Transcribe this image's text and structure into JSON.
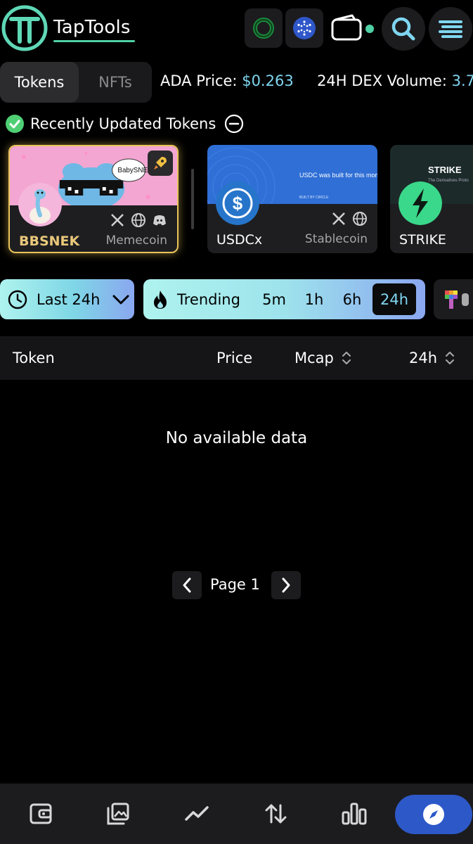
{
  "header": {
    "brand": "TapTools",
    "icons": [
      "logo-icon",
      "ring-icon",
      "cardano-icon",
      "wallet-icon",
      "search-icon",
      "menu-icon"
    ],
    "wallet_status_color": "#4fd1a5"
  },
  "tabs": [
    {
      "label": "Tokens",
      "active": true
    },
    {
      "label": "NFTs",
      "active": false
    }
  ],
  "ticker": {
    "ada_label": "ADA Price:",
    "ada_value": "$0.263",
    "volume_label": "24H DEX Volume:",
    "volume_value": "3.7"
  },
  "recent": {
    "title": "Recently Updated Tokens",
    "cards": [
      {
        "name": "BBSNEK",
        "category": "Memecoin",
        "banner_text": "BabySNE",
        "socials": [
          "x-icon",
          "globe-icon",
          "discord-icon"
        ],
        "badge": "rocket-icon"
      },
      {
        "name": "USDCx",
        "category": "Stablecoin",
        "banner_text": "USDC was built for this moment.",
        "banner_footer": "BUILT BY CIRCLE",
        "socials": [
          "x-icon",
          "globe-icon"
        ]
      },
      {
        "name": "STRIKE",
        "banner_text": "STRIKE",
        "banner_sub": "The Derivatives Proto"
      }
    ]
  },
  "filters": {
    "time": "Last 24h",
    "trending_label": "Trending",
    "timeframes": [
      {
        "label": "5m",
        "active": false
      },
      {
        "label": "1h",
        "active": false
      },
      {
        "label": "6h",
        "active": false
      },
      {
        "label": "24h",
        "active": true
      }
    ]
  },
  "table": {
    "columns": [
      "Token",
      "Price",
      "Mcap",
      "24h"
    ],
    "empty_message": "No available data"
  },
  "pagination": {
    "label": "Page 1"
  },
  "bottom_nav": {
    "items": [
      "wallet-icon",
      "gallery-icon",
      "chart-line-icon",
      "swap-icon",
      "bar-chart-icon",
      "compass-icon"
    ],
    "active": "compass-icon",
    "active_color": "#2d58c8"
  },
  "colors": {
    "accent": "#7fd6f0",
    "gold": "#e9c45a"
  }
}
